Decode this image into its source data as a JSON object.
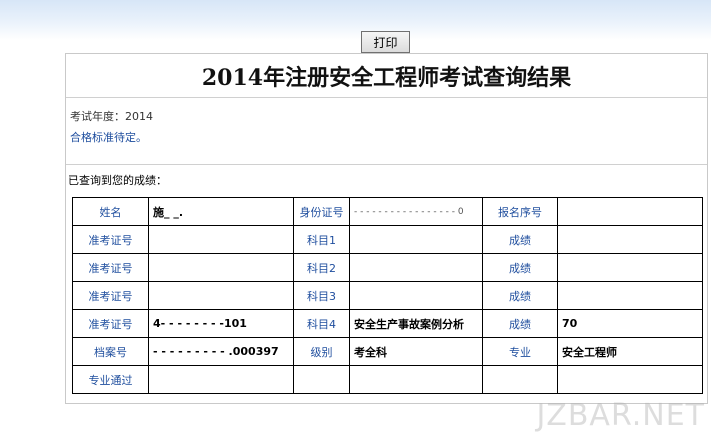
{
  "toolbar": {
    "print_label": "打印"
  },
  "page": {
    "title": "2014年注册安全工程师考试查询结果",
    "exam_year_label": "考试年度：",
    "exam_year_value": "2014",
    "standard_notice": "合格标准待定。",
    "results_heading": "已查询到您的成绩："
  },
  "table": {
    "row1": {
      "name_label": "姓名",
      "name_value": "施_ _.",
      "id_label": "身份证号",
      "id_value": "- - - - - - - - - - - - - - - - - 0",
      "reg_label": "报名序号",
      "reg_value": ""
    },
    "row2": {
      "ticket_label": "准考证号",
      "ticket_value": "",
      "subject_label": "科目1",
      "subject_value": "",
      "score_label": "成绩",
      "score_value": ""
    },
    "row3": {
      "ticket_label": "准考证号",
      "ticket_value": "",
      "subject_label": "科目2",
      "subject_value": "",
      "score_label": "成绩",
      "score_value": ""
    },
    "row4": {
      "ticket_label": "准考证号",
      "ticket_value": "",
      "subject_label": "科目3",
      "subject_value": "",
      "score_label": "成绩",
      "score_value": ""
    },
    "row5": {
      "ticket_label": "准考证号",
      "ticket_value": "4- - - - - - - -101",
      "subject_label": "科目4",
      "subject_value": "安全生产事故案例分析",
      "score_label": "成绩",
      "score_value": "70"
    },
    "row6": {
      "file_label": "档案号",
      "file_value": "- - - - - - - - -  .000397",
      "level_label": "级别",
      "level_value": "考全科",
      "major_label": "专业",
      "major_value": "安全工程师"
    },
    "row7": {
      "pass_label": "专业通过"
    }
  },
  "watermark": "JZBAR.NET"
}
